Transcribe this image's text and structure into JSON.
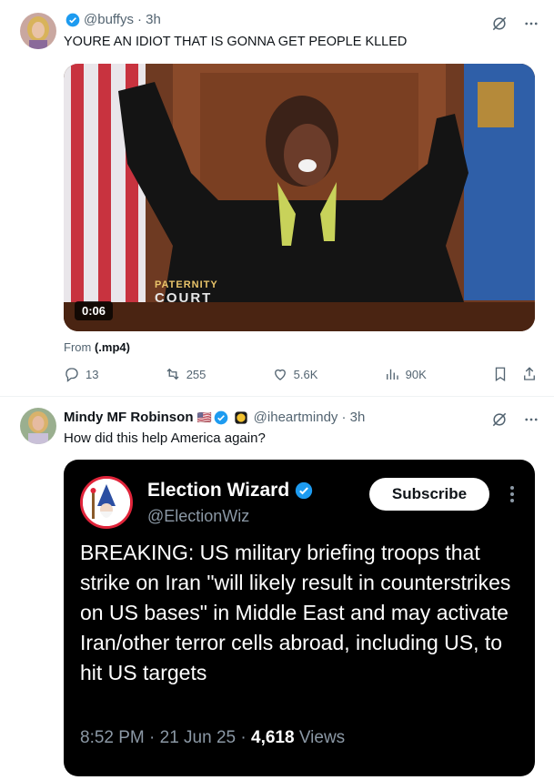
{
  "tweet1": {
    "handle": "@buffys",
    "time": "· 3h",
    "text": "YOURE AN IDIOT THAT IS GONNA GET PEOPLE KLLED",
    "video": {
      "overlay_line1": "PATERNITY",
      "overlay_line2": "COURT",
      "duration": "0:06"
    },
    "from_label": "From",
    "from_source": "(.mp4)",
    "replies": "13",
    "reposts": "255",
    "likes": "5.6K",
    "views": "90K"
  },
  "tweet2": {
    "name": "Mindy MF Robinson",
    "flag": "🇺🇸",
    "handle": "@iheartmindy",
    "time": "· 3h",
    "text": "How did this help America again?",
    "card": {
      "name": "Election Wizard",
      "handle": "@ElectionWiz",
      "subscribe_label": "Subscribe",
      "body": "BREAKING: US military briefing troops that strike on Iran \"will likely result in counterstrikes on US bases\" in Middle East and may activate Iran/other terror cells abroad, including US, to hit US targets",
      "time": "8:52 PM · 21 Jun 25 ·",
      "views_count": "4,618",
      "views_label": "Views"
    }
  },
  "colors": {
    "verified": "#1d9bf0",
    "muted": "#536471",
    "card_bg": "#000000",
    "logo_red": "#e0243a"
  },
  "icons": [
    "verified-badge-icon",
    "grok-icon",
    "more-icon",
    "reply-icon",
    "repost-icon",
    "like-icon",
    "views-icon",
    "bookmark-icon",
    "share-icon",
    "flag-icon",
    "gold-badge-icon"
  ]
}
